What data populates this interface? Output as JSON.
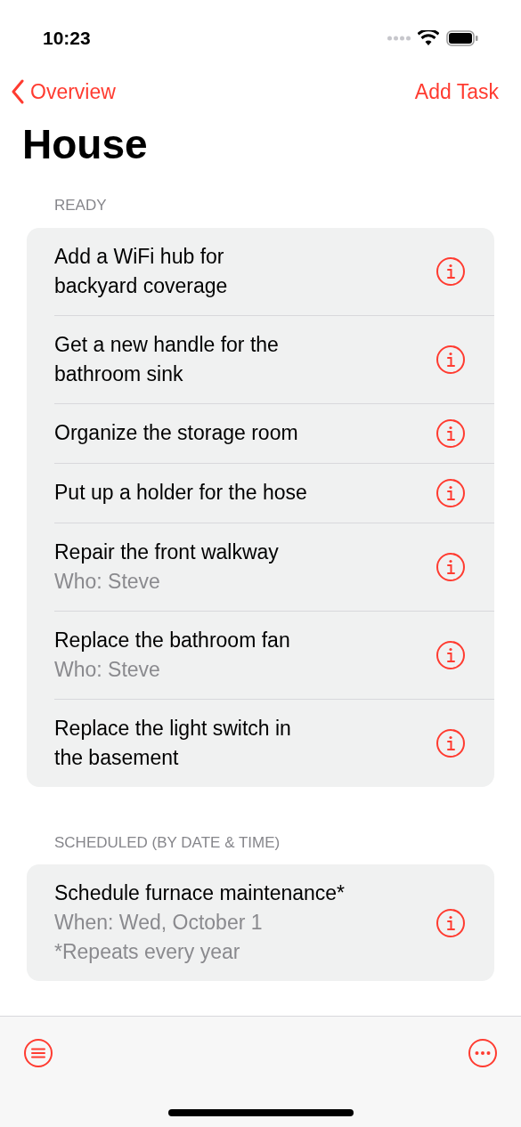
{
  "status_bar": {
    "time": "10:23"
  },
  "nav": {
    "back": "Overview",
    "action": "Add Task"
  },
  "title": "House",
  "sections": [
    {
      "header": "READY",
      "items": [
        {
          "title": "Add a WiFi hub for\nbackyard coverage"
        },
        {
          "title": "Get a new handle for the\nbathroom sink"
        },
        {
          "title": "Organize the storage room"
        },
        {
          "title": "Put up a holder for the hose"
        },
        {
          "title": "Repair the front walkway",
          "details": [
            "Who: Steve"
          ]
        },
        {
          "title": "Replace the bathroom fan",
          "details": [
            "Who: Steve"
          ]
        },
        {
          "title": "Replace the light switch in\nthe basement"
        }
      ]
    },
    {
      "header": "SCHEDULED (BY DATE & TIME)",
      "items": [
        {
          "title": "Schedule furnace maintenance*",
          "details": [
            "When: Wed, October 1",
            "*Repeats every year"
          ]
        }
      ]
    }
  ]
}
